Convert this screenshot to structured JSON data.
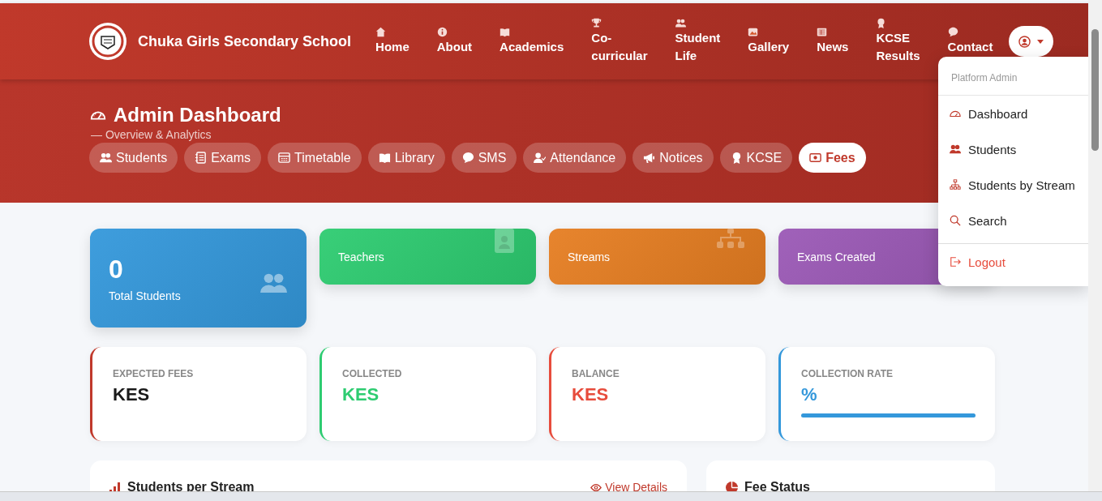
{
  "header": {
    "school_name": "Chuka Girls Secondary School",
    "nav": [
      {
        "label": "Home"
      },
      {
        "label": "About"
      },
      {
        "label": "Academics"
      },
      {
        "label": "Co-curricular"
      },
      {
        "label": "Student Life"
      },
      {
        "label": "Gallery"
      },
      {
        "label": "News"
      },
      {
        "label": "KCSE Results"
      },
      {
        "label": "Contact"
      }
    ]
  },
  "user_menu": {
    "header": "Platform Admin",
    "items": [
      {
        "label": "Dashboard",
        "kind": "item"
      },
      {
        "label": "Students",
        "kind": "item"
      },
      {
        "label": "Students by Stream",
        "kind": "item"
      },
      {
        "label": "Search",
        "kind": "item"
      },
      {
        "label": "Logout",
        "kind": "danger"
      }
    ]
  },
  "hero": {
    "title": "Admin Dashboard",
    "subtitle": "— Overview & Analytics",
    "tabs": [
      {
        "label": "Students",
        "selected": false
      },
      {
        "label": "Exams",
        "selected": false
      },
      {
        "label": "Timetable",
        "selected": false
      },
      {
        "label": "Library",
        "selected": false
      },
      {
        "label": "SMS",
        "selected": false
      },
      {
        "label": "Attendance",
        "selected": false
      },
      {
        "label": "Notices",
        "selected": false
      },
      {
        "label": "KCSE",
        "selected": false
      },
      {
        "label": "Fees",
        "selected": true
      }
    ]
  },
  "stat_cards": [
    {
      "value": "0",
      "label": "Total Students",
      "color": "#3498db"
    },
    {
      "label": "Teachers",
      "color": "#2ecc71"
    },
    {
      "label": "Streams",
      "color": "#e67e22"
    },
    {
      "label": "Exams Created",
      "color": "#9b59b6"
    }
  ],
  "fee_cards": [
    {
      "label": "EXPECTED FEES",
      "value": "KES",
      "color": "#c0392b",
      "kind": "neutral"
    },
    {
      "label": "COLLECTED",
      "value": "KES",
      "color": "#2ecc71",
      "kind": "accent"
    },
    {
      "label": "BALANCE",
      "value": "KES",
      "color": "#e74c3c",
      "kind": "accent"
    },
    {
      "label": "COLLECTION RATE",
      "value": "%",
      "color": "#3498db",
      "kind": "accent",
      "level": 1
    }
  ],
  "panels": [
    {
      "title": "Students per Stream",
      "link": "View Details"
    },
    {
      "title": "Fee Status"
    }
  ]
}
